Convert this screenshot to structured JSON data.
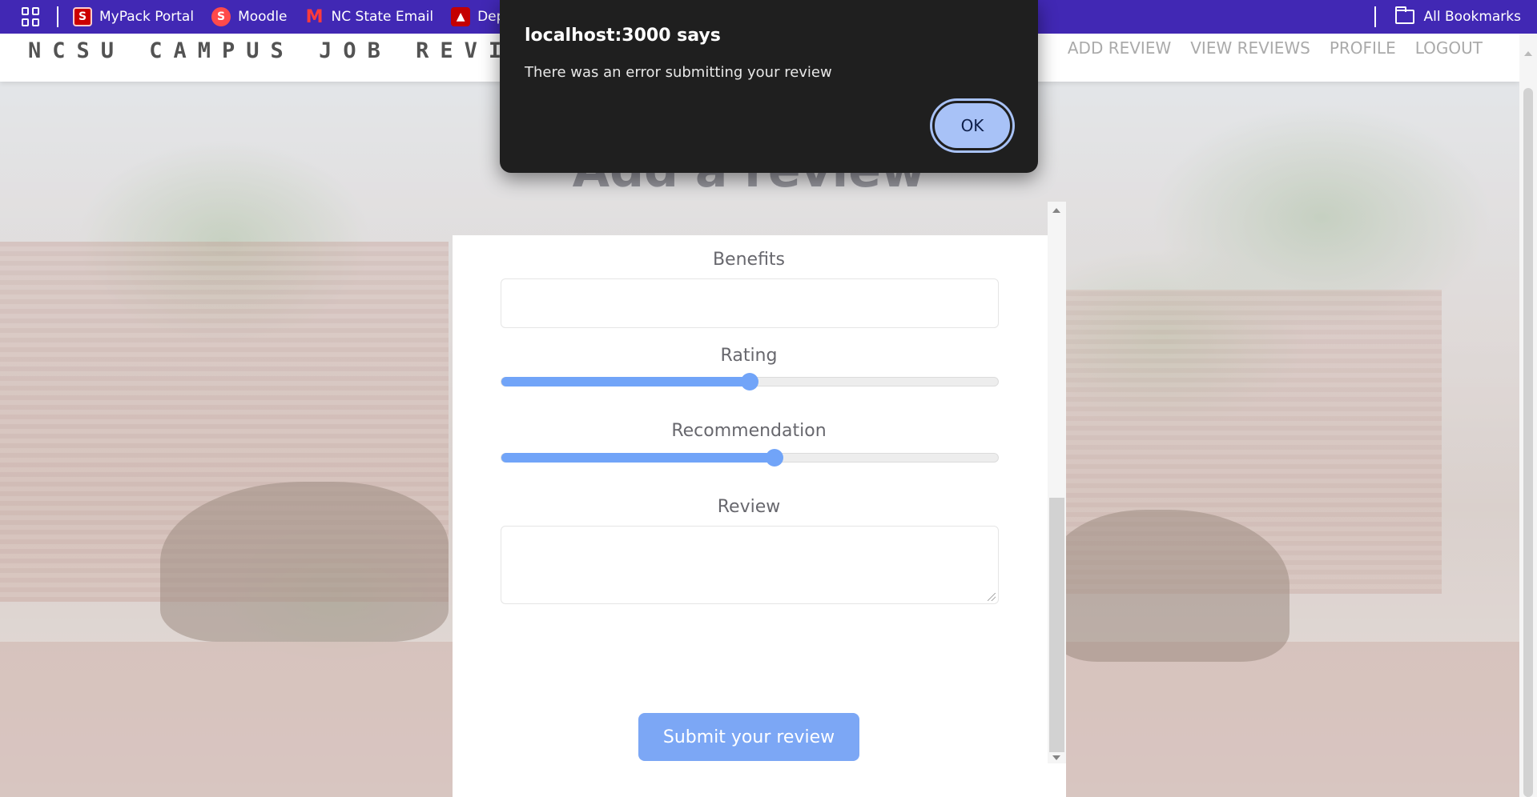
{
  "bookmarks": {
    "items": [
      {
        "label": "MyPack Portal",
        "icon": "ncsu-logo-icon"
      },
      {
        "label": "Moodle",
        "icon": "moodle-icon"
      },
      {
        "label": "NC State Email",
        "icon": "gmail-icon"
      },
      {
        "label": "Dep",
        "icon": "wolf-icon"
      }
    ],
    "all_bookmarks": "All Bookmarks"
  },
  "navbar": {
    "brand": "NCSU CAMPUS JOB REVIEW",
    "links": [
      "ADD REVIEW",
      "VIEW REVIEWS",
      "PROFILE",
      "LOGOUT"
    ]
  },
  "page": {
    "title": "Add a review"
  },
  "form": {
    "benefits_label": "Benefits",
    "benefits_value": "",
    "rating_label": "Rating",
    "rating_value": 0.5,
    "recommendation_label": "Recommendation",
    "recommendation_value": 0.55,
    "review_label": "Review",
    "review_value": "",
    "submit_label": "Submit your review"
  },
  "alert": {
    "title": "localhost:3000 says",
    "message": "There was an error submitting your review",
    "ok_label": "OK"
  },
  "colors": {
    "bookmarks_bar": "#4128b4",
    "accent": "#3b82f6",
    "submit_button": "#4a86f2",
    "alert_bg": "#1f1f1f",
    "ok_button": "#a8c2f7"
  }
}
